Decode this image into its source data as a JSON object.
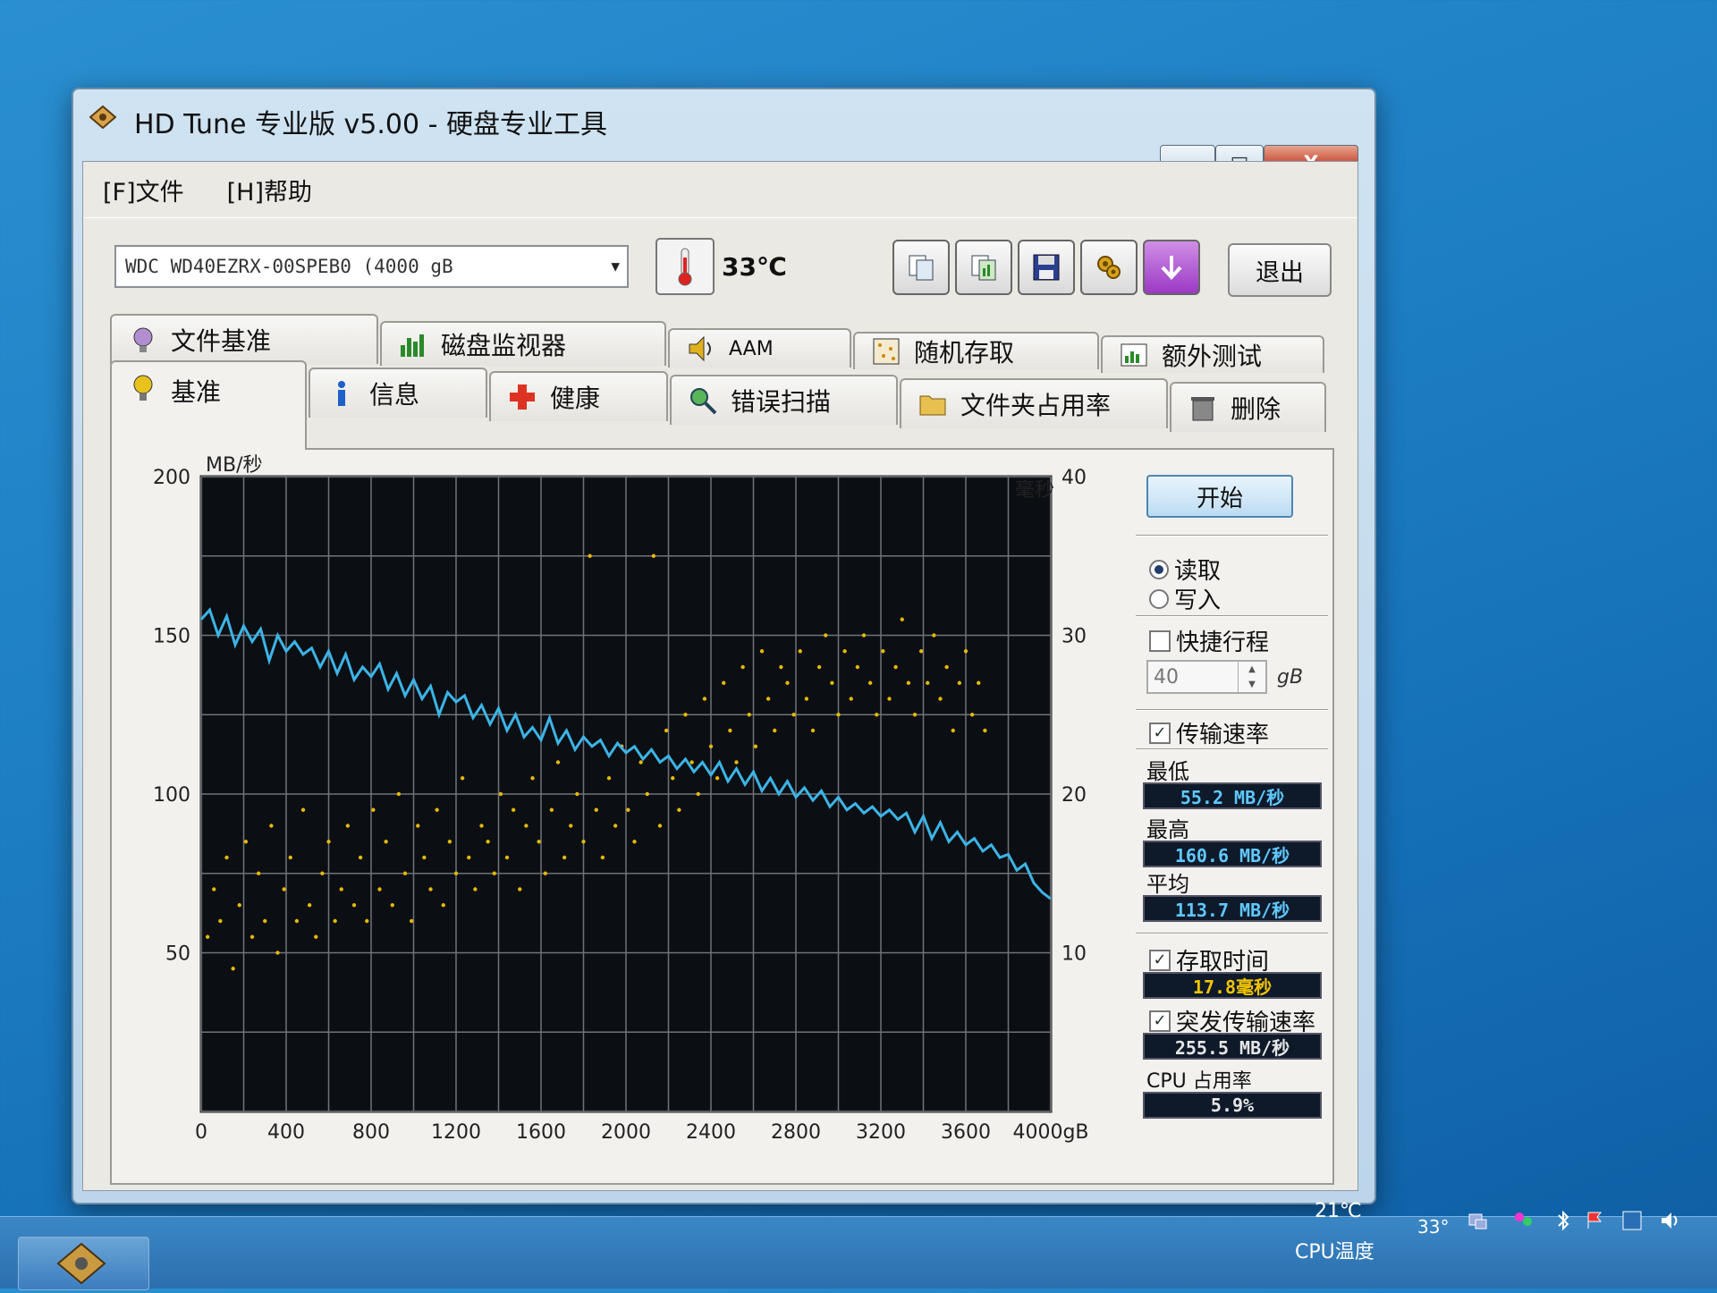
{
  "window": {
    "title": "HD Tune 专业版 v5.00 - 硬盘专业工具",
    "close_label": "X",
    "min_label": "—",
    "max_label": "□"
  },
  "menu": {
    "file": "[F]文件",
    "help": "[H]帮助"
  },
  "toolbar": {
    "drive": "WDC  WD40EZRX-00SPEB0         (4000  gB",
    "temperature": "33℃",
    "exit_label": "退出"
  },
  "tabs": {
    "row1": [
      {
        "label": "文件基准"
      },
      {
        "label": "磁盘监视器"
      },
      {
        "label": "AAM"
      },
      {
        "label": "随机存取"
      },
      {
        "label": "额外测试"
      }
    ],
    "row2": [
      {
        "label": "基准"
      },
      {
        "label": "信息"
      },
      {
        "label": "健康"
      },
      {
        "label": "错误扫描"
      },
      {
        "label": "文件夹占用率"
      },
      {
        "label": "删除"
      }
    ]
  },
  "controls": {
    "start_label": "开始",
    "read_label": "读取",
    "write_label": "写入",
    "shortstroke_label": "快捷行程",
    "shortstroke_value": "40",
    "shortstroke_unit": "gB",
    "transfer_rate_label": "传输速率",
    "min_label": "最低",
    "min_value": "55.2 MB/秒",
    "max_label": "最高",
    "max_value": "160.6 MB/秒",
    "avg_label": "平均",
    "avg_value": "113.7 MB/秒",
    "access_time_label": "存取时间",
    "access_time_value": "17.8毫秒",
    "burst_label": "突发传输速率",
    "burst_value": "255.5 MB/秒",
    "cpu_label": "CPU 占用率",
    "cpu_value": "5.9%"
  },
  "chart_data": {
    "type": "line",
    "y_left_label": "MB/秒",
    "y_right_label": "毫秒",
    "x_unit": "gB",
    "y_left_range": [
      0,
      200
    ],
    "y_right_range": [
      0,
      40
    ],
    "x_range": [
      0,
      4000
    ],
    "x_ticks": [
      "0",
      "400",
      "800",
      "1200",
      "1600",
      "2000",
      "2400",
      "2800",
      "3200",
      "3600",
      "4000gB"
    ],
    "y_left_ticks": [
      "50",
      "100",
      "150",
      "200"
    ],
    "y_right_ticks": [
      "10",
      "20",
      "30",
      "40"
    ],
    "grid": true,
    "series": [
      {
        "color": "#3cb4e6",
        "x": [
          0,
          40,
          80,
          120,
          160,
          200,
          240,
          280,
          320,
          360,
          400,
          440,
          480,
          520,
          560,
          600,
          640,
          680,
          720,
          760,
          800,
          840,
          880,
          920,
          960,
          1000,
          1040,
          1080,
          1120,
          1160,
          1200,
          1240,
          1280,
          1320,
          1360,
          1400,
          1440,
          1480,
          1520,
          1560,
          1600,
          1640,
          1680,
          1720,
          1760,
          1800,
          1840,
          1880,
          1920,
          1960,
          2000,
          2040,
          2080,
          2120,
          2160,
          2200,
          2240,
          2280,
          2320,
          2360,
          2400,
          2440,
          2480,
          2520,
          2560,
          2600,
          2640,
          2680,
          2720,
          2760,
          2800,
          2840,
          2880,
          2920,
          2960,
          3000,
          3040,
          3080,
          3120,
          3160,
          3200,
          3240,
          3280,
          3320,
          3360,
          3400,
          3440,
          3480,
          3520,
          3560,
          3600,
          3640,
          3680,
          3720,
          3760,
          3800,
          3840,
          3880,
          3920,
          3960,
          4000
        ],
        "y": [
          155,
          158,
          150,
          156,
          147,
          153,
          148,
          152,
          142,
          150,
          145,
          148,
          144,
          146,
          140,
          145,
          138,
          144,
          136,
          140,
          137,
          141,
          133,
          138,
          131,
          136,
          130,
          134,
          125,
          132,
          129,
          131,
          124,
          128,
          122,
          127,
          120,
          125,
          118,
          121,
          117,
          124,
          116,
          120,
          114,
          118,
          115,
          117,
          112,
          116,
          113,
          115,
          111,
          114,
          110,
          112,
          108,
          111,
          107,
          110,
          106,
          110,
          104,
          108,
          103,
          107,
          101,
          105,
          100,
          104,
          99,
          102,
          98,
          101,
          96,
          99,
          95,
          97,
          94,
          96,
          93,
          95,
          92,
          94,
          88,
          93,
          86,
          91,
          85,
          88,
          84,
          86,
          82,
          84,
          80,
          81,
          76,
          78,
          72,
          69,
          67
        ]
      }
    ],
    "access_time_points_ms": [
      {
        "x": 30,
        "y": 11
      },
      {
        "x": 60,
        "y": 14
      },
      {
        "x": 90,
        "y": 12
      },
      {
        "x": 120,
        "y": 16
      },
      {
        "x": 150,
        "y": 9
      },
      {
        "x": 180,
        "y": 13
      },
      {
        "x": 210,
        "y": 17
      },
      {
        "x": 240,
        "y": 11
      },
      {
        "x": 270,
        "y": 15
      },
      {
        "x": 300,
        "y": 12
      },
      {
        "x": 330,
        "y": 18
      },
      {
        "x": 360,
        "y": 10
      },
      {
        "x": 390,
        "y": 14
      },
      {
        "x": 420,
        "y": 16
      },
      {
        "x": 450,
        "y": 12
      },
      {
        "x": 480,
        "y": 19
      },
      {
        "x": 510,
        "y": 13
      },
      {
        "x": 540,
        "y": 11
      },
      {
        "x": 570,
        "y": 15
      },
      {
        "x": 600,
        "y": 17
      },
      {
        "x": 630,
        "y": 12
      },
      {
        "x": 660,
        "y": 14
      },
      {
        "x": 690,
        "y": 18
      },
      {
        "x": 720,
        "y": 13
      },
      {
        "x": 750,
        "y": 16
      },
      {
        "x": 780,
        "y": 12
      },
      {
        "x": 810,
        "y": 19
      },
      {
        "x": 840,
        "y": 14
      },
      {
        "x": 870,
        "y": 17
      },
      {
        "x": 900,
        "y": 13
      },
      {
        "x": 930,
        "y": 20
      },
      {
        "x": 960,
        "y": 15
      },
      {
        "x": 990,
        "y": 12
      },
      {
        "x": 1020,
        "y": 18
      },
      {
        "x": 1050,
        "y": 16
      },
      {
        "x": 1080,
        "y": 14
      },
      {
        "x": 1110,
        "y": 19
      },
      {
        "x": 1140,
        "y": 13
      },
      {
        "x": 1170,
        "y": 17
      },
      {
        "x": 1200,
        "y": 15
      },
      {
        "x": 1230,
        "y": 21
      },
      {
        "x": 1260,
        "y": 16
      },
      {
        "x": 1290,
        "y": 14
      },
      {
        "x": 1320,
        "y": 18
      },
      {
        "x": 1350,
        "y": 17
      },
      {
        "x": 1380,
        "y": 15
      },
      {
        "x": 1410,
        "y": 20
      },
      {
        "x": 1440,
        "y": 16
      },
      {
        "x": 1470,
        "y": 19
      },
      {
        "x": 1500,
        "y": 14
      },
      {
        "x": 1530,
        "y": 18
      },
      {
        "x": 1560,
        "y": 21
      },
      {
        "x": 1590,
        "y": 17
      },
      {
        "x": 1620,
        "y": 15
      },
      {
        "x": 1650,
        "y": 19
      },
      {
        "x": 1680,
        "y": 22
      },
      {
        "x": 1710,
        "y": 16
      },
      {
        "x": 1740,
        "y": 18
      },
      {
        "x": 1770,
        "y": 20
      },
      {
        "x": 1800,
        "y": 17
      },
      {
        "x": 1830,
        "y": 35
      },
      {
        "x": 1860,
        "y": 19
      },
      {
        "x": 1890,
        "y": 16
      },
      {
        "x": 1920,
        "y": 21
      },
      {
        "x": 1950,
        "y": 18
      },
      {
        "x": 1980,
        "y": 23
      },
      {
        "x": 2010,
        "y": 19
      },
      {
        "x": 2040,
        "y": 17
      },
      {
        "x": 2070,
        "y": 22
      },
      {
        "x": 2100,
        "y": 20
      },
      {
        "x": 2130,
        "y": 35
      },
      {
        "x": 2160,
        "y": 18
      },
      {
        "x": 2190,
        "y": 24
      },
      {
        "x": 2220,
        "y": 21
      },
      {
        "x": 2250,
        "y": 19
      },
      {
        "x": 2280,
        "y": 25
      },
      {
        "x": 2310,
        "y": 22
      },
      {
        "x": 2340,
        "y": 20
      },
      {
        "x": 2370,
        "y": 26
      },
      {
        "x": 2400,
        "y": 23
      },
      {
        "x": 2430,
        "y": 21
      },
      {
        "x": 2460,
        "y": 27
      },
      {
        "x": 2490,
        "y": 24
      },
      {
        "x": 2520,
        "y": 22
      },
      {
        "x": 2550,
        "y": 28
      },
      {
        "x": 2580,
        "y": 25
      },
      {
        "x": 2610,
        "y": 23
      },
      {
        "x": 2640,
        "y": 29
      },
      {
        "x": 2670,
        "y": 26
      },
      {
        "x": 2700,
        "y": 24
      },
      {
        "x": 2730,
        "y": 28
      },
      {
        "x": 2760,
        "y": 27
      },
      {
        "x": 2790,
        "y": 25
      },
      {
        "x": 2820,
        "y": 29
      },
      {
        "x": 2850,
        "y": 26
      },
      {
        "x": 2880,
        "y": 24
      },
      {
        "x": 2910,
        "y": 28
      },
      {
        "x": 2940,
        "y": 30
      },
      {
        "x": 2970,
        "y": 27
      },
      {
        "x": 3000,
        "y": 25
      },
      {
        "x": 3030,
        "y": 29
      },
      {
        "x": 3060,
        "y": 26
      },
      {
        "x": 3090,
        "y": 28
      },
      {
        "x": 3120,
        "y": 30
      },
      {
        "x": 3150,
        "y": 27
      },
      {
        "x": 3180,
        "y": 25
      },
      {
        "x": 3210,
        "y": 29
      },
      {
        "x": 3240,
        "y": 26
      },
      {
        "x": 3270,
        "y": 28
      },
      {
        "x": 3300,
        "y": 31
      },
      {
        "x": 3330,
        "y": 27
      },
      {
        "x": 3360,
        "y": 25
      },
      {
        "x": 3390,
        "y": 29
      },
      {
        "x": 3420,
        "y": 27
      },
      {
        "x": 3450,
        "y": 30
      },
      {
        "x": 3480,
        "y": 26
      },
      {
        "x": 3510,
        "y": 28
      },
      {
        "x": 3540,
        "y": 24
      },
      {
        "x": 3570,
        "y": 27
      },
      {
        "x": 3600,
        "y": 29
      },
      {
        "x": 3630,
        "y": 25
      },
      {
        "x": 3660,
        "y": 27
      },
      {
        "x": 3690,
        "y": 24
      }
    ]
  },
  "taskbar": {
    "cpu_temp_value": "21℃",
    "cpu_temp_label": "CPU温度",
    "tray_value": "33°"
  }
}
